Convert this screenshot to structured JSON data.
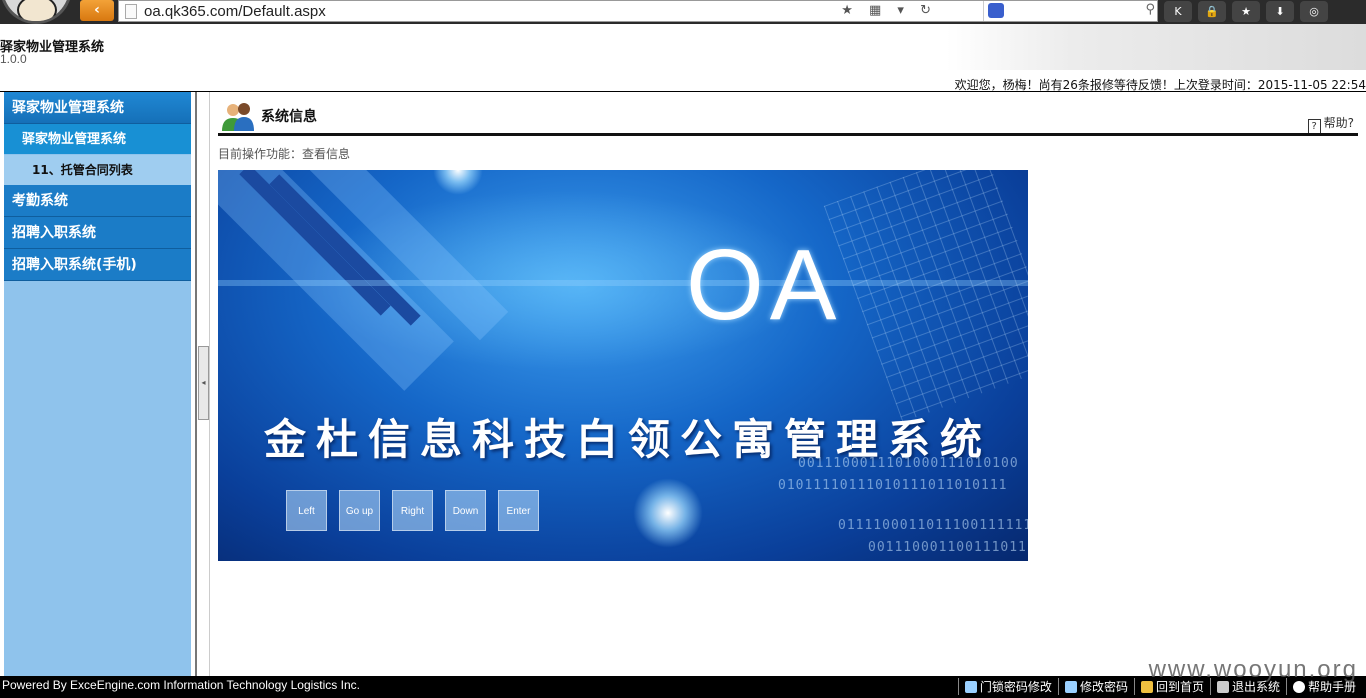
{
  "browser": {
    "url": "oa.qk365.com/Default.aspx",
    "back_glyph": "‹",
    "url_icons": "★ ▦ ▾ ↻",
    "search_icon": "⚲",
    "ext_icons": [
      {
        "name": "k-icon",
        "glyph": "K"
      },
      {
        "name": "lock-icon",
        "glyph": "🔒"
      },
      {
        "name": "star-icon",
        "glyph": "★"
      },
      {
        "name": "download-icon",
        "glyph": "⬇"
      },
      {
        "name": "gamepad-icon",
        "glyph": "◎"
      }
    ]
  },
  "header": {
    "system_title": "驿家物业管理系统",
    "version": "1.0.0",
    "welcome_text": "欢迎您，杨梅！尚有26条报修等待反馈！上次登录时间：2015-11-05 22:54"
  },
  "sidebar": {
    "items": [
      {
        "label": "驿家物业管理系统",
        "level": 1
      },
      {
        "label": "驿家物业管理系统",
        "level": 2
      },
      {
        "label": "11、托管合同列表",
        "level": 3
      },
      {
        "label": "考勤系统",
        "level": 1
      },
      {
        "label": "招聘入职系统",
        "level": 1
      },
      {
        "label": "招聘入职系统(手机)",
        "level": 1
      }
    ],
    "collapse_glyph": "◂"
  },
  "content": {
    "title": "系统信息",
    "help_label": "帮助?",
    "help_glyph": "?",
    "current_op": "目前操作功能：查看信息"
  },
  "banner": {
    "logo_text": "OA",
    "slogan": "金杜信息科技白领公寓管理系统",
    "binary_lines": [
      "0011100011101000111010100",
      "01011110111010111011010111",
      "01111000110111001111111",
      "0011100011001110111011"
    ],
    "keys": [
      "Left",
      "Go up",
      "Right",
      "Down",
      "Enter"
    ]
  },
  "footer": {
    "powered_by": "Powered By ExceEngine.com Information Technology Logistics Inc.",
    "links": [
      "门锁密码修改",
      "修改密码",
      "回到首页",
      "退出系统",
      "帮助手册"
    ],
    "watermark": "www.wooyun.org"
  },
  "colors": {
    "nav_primary": "#1b7cc7",
    "nav_secondary": "#1890d4",
    "sidebar_bg": "#8fc3ec",
    "footer_bg": "#000000"
  }
}
